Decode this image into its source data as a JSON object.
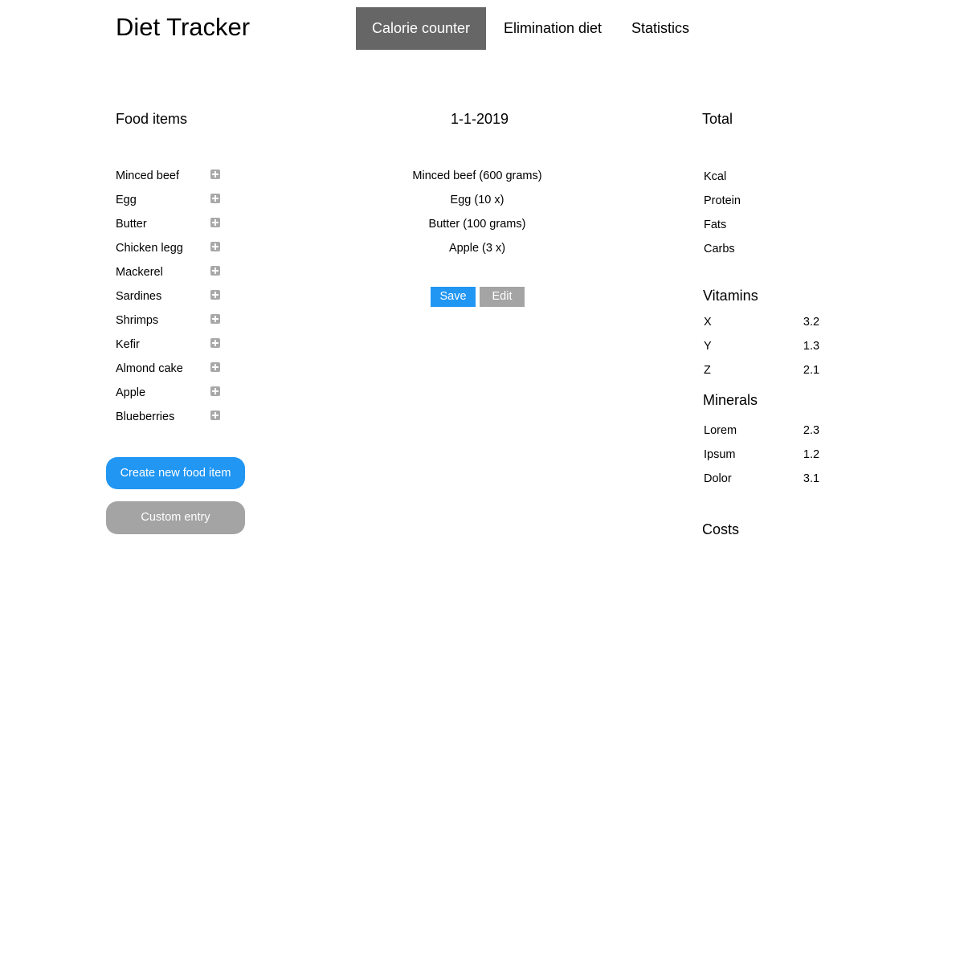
{
  "app": {
    "title": "Diet Tracker"
  },
  "nav": {
    "tabs": [
      {
        "label": "Calorie counter",
        "active": true
      },
      {
        "label": "Elimination diet",
        "active": false
      },
      {
        "label": "Statistics",
        "active": false
      }
    ]
  },
  "food_items": {
    "heading": "Food items",
    "items": [
      {
        "label": "Minced beef",
        "icon": "plus-square-icon"
      },
      {
        "label": "Egg",
        "icon": "plus-square-icon"
      },
      {
        "label": "Butter",
        "icon": "plus-square-icon"
      },
      {
        "label": "Chicken legg",
        "icon": "plus-square-icon"
      },
      {
        "label": "Mackerel",
        "icon": "plus-square-icon"
      },
      {
        "label": "Sardines",
        "icon": "plus-square-icon"
      },
      {
        "label": "Shrimps",
        "icon": "plus-square-icon"
      },
      {
        "label": "Kefir",
        "icon": "plus-square-icon"
      },
      {
        "label": "Almond cake",
        "icon": "plus-square-icon"
      },
      {
        "label": "Apple",
        "icon": "plus-square-icon"
      },
      {
        "label": "Blueberries",
        "icon": "plus-square-icon"
      }
    ],
    "create_label": "Create new food item",
    "custom_label": "Custom entry"
  },
  "day": {
    "date": "1-1-2019",
    "entries": [
      "Minced beef (600 grams)",
      "Egg (10 x)",
      "Butter (100 grams)",
      "Apple (3 x)"
    ],
    "save_label": "Save",
    "edit_label": "Edit"
  },
  "totals": {
    "heading": "Total",
    "macros": [
      "Kcal",
      "Protein",
      "Fats",
      "Carbs"
    ],
    "vitamins_heading": "Vitamins",
    "vitamins": [
      {
        "name": "X",
        "value": "3.2"
      },
      {
        "name": "Y",
        "value": "1.3"
      },
      {
        "name": "Z",
        "value": "2.1"
      }
    ],
    "minerals_heading": "Minerals",
    "minerals": [
      {
        "name": "Lorem",
        "value": "2.3"
      },
      {
        "name": "Ipsum",
        "value": "1.2"
      },
      {
        "name": "Dolor",
        "value": "3.1"
      }
    ],
    "costs_heading": "Costs"
  },
  "colors": {
    "active_tab": "#666666",
    "primary": "#2196f3",
    "secondary": "#a4a4a4",
    "icon": "#a8a8a8"
  }
}
